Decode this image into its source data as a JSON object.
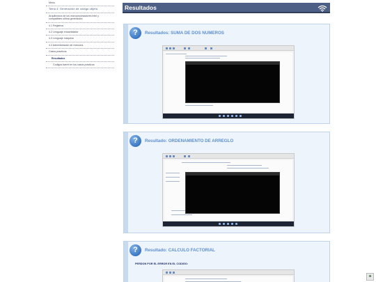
{
  "sidebar": {
    "items": [
      "Menu",
      "Tema 4: Generación de código objeto.",
      "Arquitectura de los microprocesadores intel y compatibles ultima generación",
      "4.1 Registros",
      "4.2 Lenguaje ensamblador",
      "4.3 Lenguaje máquina",
      "4.4 Administración de memoria",
      "Casos practicos",
      "Resultados",
      "Codigos barrel en los casos practicos"
    ]
  },
  "header": {
    "title": "Resultados",
    "icon": "wifi-icon"
  },
  "cards": [
    {
      "title": "Resultados: SUMA DE DOS NUMEROS",
      "note": ""
    },
    {
      "title": "Resultado: ORDENAMIENTO DE ARREGLO",
      "note": ""
    },
    {
      "title": "Resultado: CALCULO FACTORIAL",
      "note": "PERDON POR EL ERROR EN EL CODIGO:"
    }
  ],
  "icons": {
    "help": "help-question-icon",
    "corner": "puzzle-icon"
  },
  "colors": {
    "header": "#4e5f85",
    "card_bg": "#eef4fb",
    "card_title": "#5b8fd0",
    "terminal": "#050505"
  }
}
